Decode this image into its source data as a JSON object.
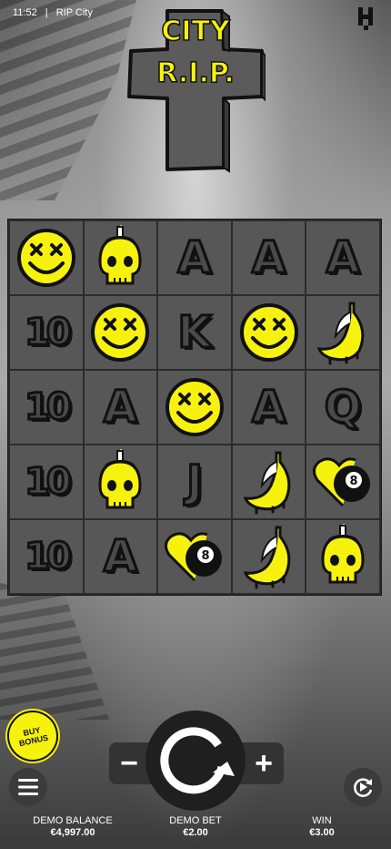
{
  "status_bar": {
    "time": "11:52",
    "app": "RIP City"
  },
  "logo": {
    "line1": "R.I.P.",
    "line2": "CITY"
  },
  "colors": {
    "accent": "#f6f20d",
    "tile": "#575757",
    "panel": "#333333"
  },
  "reels": [
    [
      "smiley",
      "skull",
      "A",
      "A",
      "A"
    ],
    [
      "10",
      "smiley",
      "K",
      "smiley",
      "banana"
    ],
    [
      "10",
      "A",
      "smiley",
      "A",
      "Q"
    ],
    [
      "10",
      "skull",
      "J",
      "banana",
      "heart8"
    ],
    [
      "10",
      "A",
      "heart8",
      "banana",
      "skull"
    ]
  ],
  "controls": {
    "buy_bonus": "BUY BONUS",
    "minus": "−",
    "plus": "+",
    "menu_icon": "hamburger-icon",
    "spin_icon": "spin-arrow-icon",
    "autoplay_icon": "autoplay-icon"
  },
  "footer": {
    "balance_label": "DEMO BALANCE",
    "balance_value": "€4,997.00",
    "bet_label": "DEMO BET",
    "bet_value": "€2.00",
    "win_label": "WIN",
    "win_value": "€3.00"
  }
}
